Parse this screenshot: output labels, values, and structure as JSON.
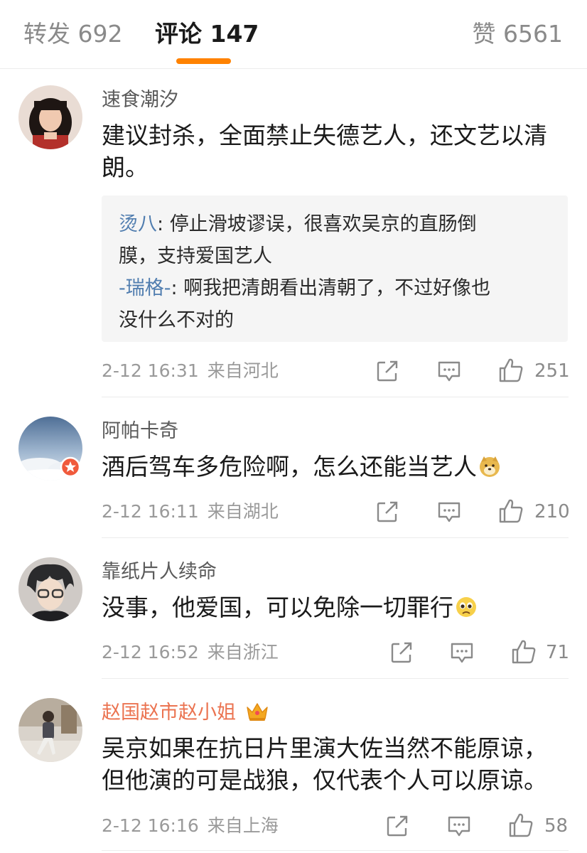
{
  "tabs": {
    "reposts": "转发 692",
    "comments": "评论 147",
    "likes": "赞 6561"
  },
  "comments": [
    {
      "user": "速食潮汐",
      "text_line1": "建议封杀，全面禁止失德艺人，还文艺以清",
      "text_line2": "朗。",
      "replies": [
        {
          "user": "烫八",
          "sep": ": ",
          "line1": "停止滑坡谬误，很喜欢吴京的直肠倒",
          "line2": "膜，支持爱国艺人"
        },
        {
          "user": "-瑞格-",
          "sep": ": ",
          "line1": "啊我把清朗看出清朝了，不过好像也",
          "line2": "没什么不对的"
        }
      ],
      "time": "2-12 16:31",
      "location": "来自河北",
      "likes": "251"
    },
    {
      "user": "阿帕卡奇",
      "text": "酒后驾车多危险啊，怎么还能当艺人",
      "emoji": "doge-emoji",
      "time": "2-12 16:11",
      "location": "来自湖北",
      "likes": "210"
    },
    {
      "user": "靠纸片人续命",
      "text": "没事，他爱国，可以免除一切罪行",
      "emoji": "pleading-emoji",
      "time": "2-12 16:52",
      "location": "来自浙江",
      "likes": "71"
    },
    {
      "user": "赵国赵市赵小姐",
      "user_badge": "crown-icon",
      "text_line1": "吴京如果在抗日片里演大佐当然不能原谅，",
      "text_line2": "但他演的可是战狼，仅代表个人可以原谅。",
      "time": "2-12 16:16",
      "location": "来自上海",
      "likes": "58"
    }
  ],
  "colors": {
    "accent": "#ff8200",
    "reply_user": "#507daf",
    "vip_user": "#eb7350",
    "meta_text": "#9a9a9a"
  }
}
